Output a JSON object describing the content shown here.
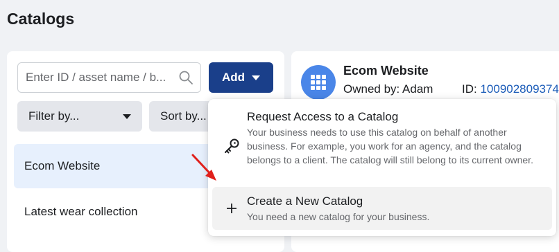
{
  "page": {
    "title": "Catalogs"
  },
  "left_panel": {
    "search": {
      "placeholder": "Enter ID / asset name / b..."
    },
    "add_button": {
      "label": "Add"
    },
    "filter_button": {
      "label": "Filter by..."
    },
    "sort_button": {
      "label": "Sort by..."
    },
    "catalogs": [
      {
        "name": "Ecom Website",
        "selected": true
      },
      {
        "name": "Latest wear collection",
        "selected": false
      }
    ]
  },
  "right_panel": {
    "catalog_name": "Ecom Website",
    "owned_by": "Owned by: Adam",
    "id_label": "ID: ",
    "id_value": "100902809374"
  },
  "add_menu": {
    "items": [
      {
        "icon": "key-icon",
        "title": "Request Access to a Catalog",
        "description": "Your business needs to use this catalog on behalf of another business. For example, you work for an agency, and the catalog belongs to a client. The catalog will still belong to its current owner."
      },
      {
        "icon": "plus-icon",
        "title": "Create a New Catalog",
        "description": "You need a new catalog for your business."
      }
    ]
  },
  "colors": {
    "primary": "#1a3f8a",
    "link": "#1a5bb8",
    "selected_row": "#e7f0fd",
    "annotation_arrow": "#e0201c"
  }
}
